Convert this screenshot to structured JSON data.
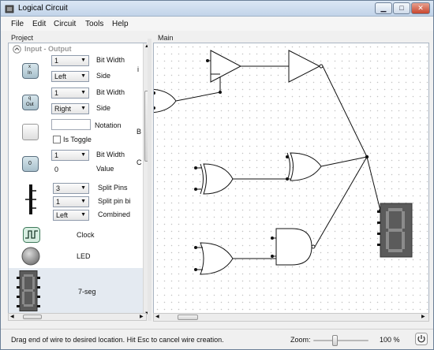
{
  "window": {
    "title": "Logical Circuit"
  },
  "menu": {
    "items": [
      "File",
      "Edit",
      "Circuit",
      "Tools",
      "Help"
    ]
  },
  "project": {
    "label": "Project",
    "section_title": "Input - Output",
    "input_row": {
      "bit_width": "1",
      "bit_width_label": "Bit Width",
      "side": "Left",
      "side_label": "Side",
      "icon_text_top": "x",
      "icon_text_bottom": "In"
    },
    "output_row": {
      "bit_width": "1",
      "bit_width_label": "Bit Width",
      "side": "Right",
      "side_label": "Side",
      "icon_text_top": "q",
      "icon_text_bottom": "Out"
    },
    "button_row": {
      "notation_label": "Notation",
      "is_toggle_label": "Is Toggle"
    },
    "constant_row": {
      "bit_width": "1",
      "bit_width_label": "Bit Width",
      "value": "0",
      "value_label": "Value",
      "icon_text": "0"
    },
    "splitter_row": {
      "split_pins": "3",
      "split_pins_label": "Split Pins",
      "split_pin_bit": "1",
      "split_pin_bit_label": "Split pin bi",
      "combined": "Left",
      "combined_label": "Combined"
    },
    "clock_label": "Clock",
    "led_label": "LED",
    "seg_label": "7-seg",
    "clipped_right": {
      "r1": "i",
      "r2": "B",
      "r3": "C"
    }
  },
  "main": {
    "label": "Main"
  },
  "status": {
    "message": "Drag end of wire to desired location. Hit Esc to cancel wire creation.",
    "zoom_label": "Zoom:",
    "zoom_value": "100 %"
  },
  "icons": [
    "app-icon",
    "minimize-icon",
    "maximize-icon",
    "close-icon",
    "chevron-up-icon",
    "power-icon"
  ]
}
